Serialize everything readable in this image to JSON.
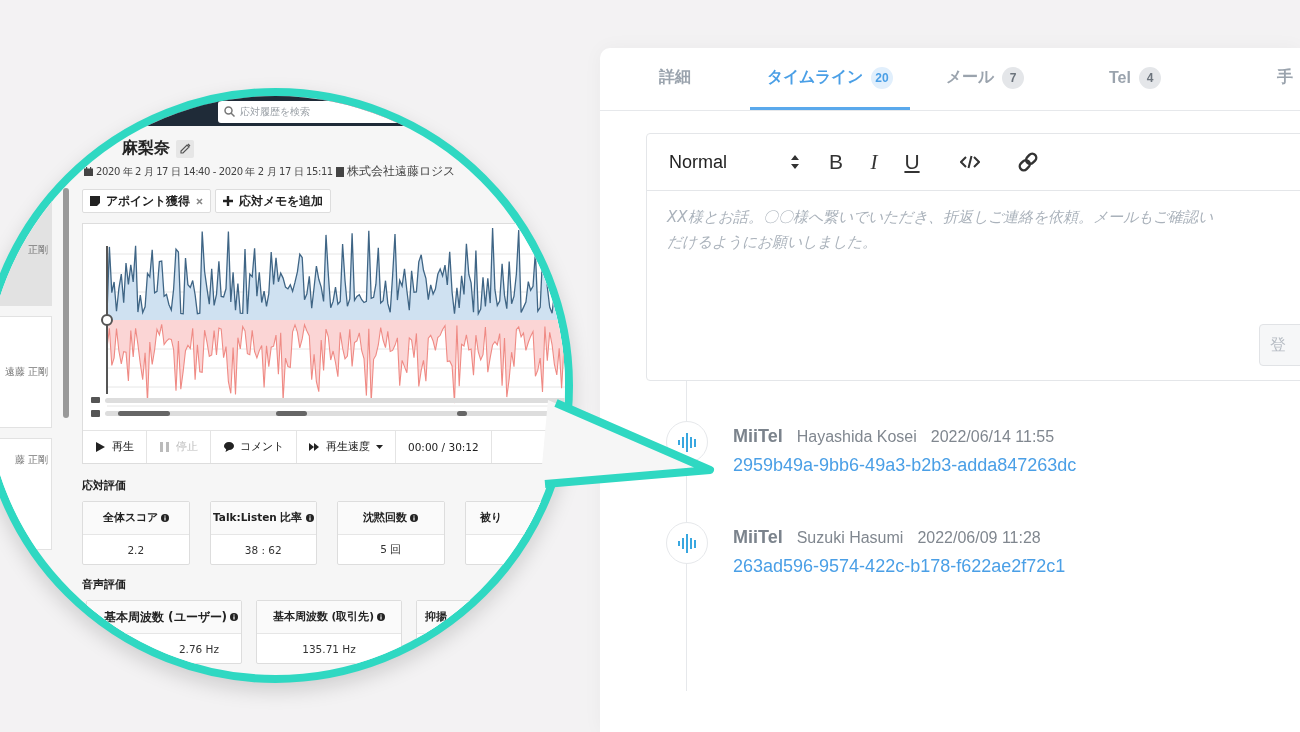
{
  "magnifier": {
    "search": {
      "placeholder": "応対履歴を検索"
    },
    "sidebar": {
      "items": [
        {
          "name": "正剛",
          "selected": true
        },
        {
          "name": "遠藤 正剛",
          "selected": false
        },
        {
          "name": "藤 正剛",
          "selected": false
        }
      ]
    },
    "record": {
      "name": "麻梨奈",
      "period": "2020 年 2 月 17 日 14:40 - 2020 年 2 月 17 日 15:11",
      "company": "株式会社遠藤ロジス"
    },
    "tags": [
      {
        "label": "アポイント獲得",
        "kind": "tag"
      },
      {
        "label": "応対メモを追加",
        "kind": "add"
      }
    ],
    "player": {
      "controls": [
        {
          "label": "再生",
          "kind": "play",
          "disabled": false
        },
        {
          "label": "停止",
          "kind": "pause",
          "disabled": true
        },
        {
          "label": "コメント",
          "kind": "comment",
          "disabled": false
        },
        {
          "label": "再生速度",
          "kind": "speed",
          "disabled": false
        }
      ],
      "time": "00:00 / 30:12"
    },
    "sections": [
      {
        "title": "応対評価",
        "cards": [
          {
            "label": "全体スコア",
            "value": "2.2"
          },
          {
            "label": "Talk:Listen 比率",
            "value": "38 : 62"
          },
          {
            "label": "沈黙回数",
            "value": "5 回"
          },
          {
            "label": "被り"
          }
        ]
      },
      {
        "title": "音声評価",
        "cards": [
          {
            "label": "基本周波数 (ユーザー)",
            "value": "2.76 Hz"
          },
          {
            "label": "基本周波数 (取引先)",
            "value": "135.71 Hz"
          },
          {
            "label": "抑揚"
          }
        ]
      }
    ]
  },
  "panel": {
    "tabs": [
      {
        "label": "詳細",
        "selected": false
      },
      {
        "label": "タイムライン",
        "count": "20",
        "selected": true
      },
      {
        "label": "メール",
        "count": "7",
        "selected": false
      },
      {
        "label": "Tel",
        "count": "4",
        "selected": false
      },
      {
        "label": "手",
        "selected": false
      }
    ],
    "editor": {
      "format": "Normal",
      "toolbar": [
        {
          "label": "B",
          "kind": "bold"
        },
        {
          "label": "I",
          "kind": "italic"
        },
        {
          "label": "U",
          "kind": "underline"
        },
        {
          "kind": "code"
        },
        {
          "kind": "link"
        }
      ],
      "placeholder": "XX様とお話。〇〇様へ繋いでいただき、折返しご連絡を依頼。メールもご確認いだけるようにお願いしました。",
      "submit": "登"
    },
    "timeline": [
      {
        "source": "MiiTel",
        "user": "Hayashida Kosei",
        "time": "2022/06/14 11:55",
        "link": "2959b49a-9bb6-49a3-b2b3-adda847263dc"
      },
      {
        "source": "MiiTel",
        "user": "Suzuki Hasumi",
        "time": "2022/06/09 11:28",
        "link": "263ad596-9574-422c-b178-f622ae2f72c1"
      }
    ]
  }
}
